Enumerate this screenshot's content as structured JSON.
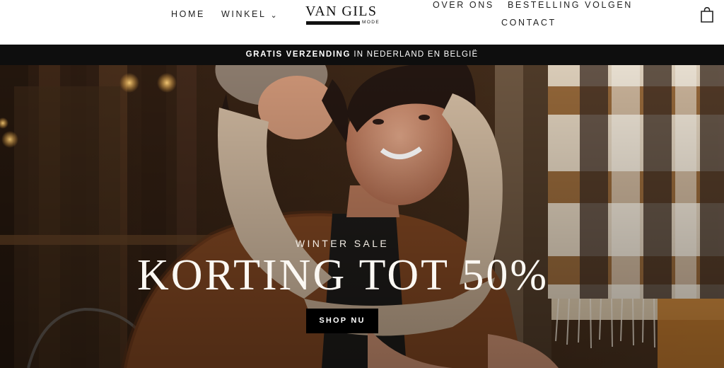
{
  "header": {
    "nav_left": {
      "home": "HOME",
      "winkel": "WINKEL"
    },
    "nav_right": {
      "over_ons": "OVER ONS",
      "bestelling": "BESTELLING VOLGEN",
      "contact": "CONTACT"
    },
    "logo": {
      "name": "VAN GILS",
      "sub": "MODE"
    },
    "cart_icon": "shopping-bag-icon"
  },
  "announcement": {
    "bold": "GRATIS VERZENDING",
    "text": " IN NEDERLAND EN BELGIË"
  },
  "hero": {
    "kicker": "WINTER SALE",
    "title": "KORTING TOT 50%",
    "button": "SHOP NU"
  },
  "colors": {
    "announcement_bg": "#0e0e0e",
    "button_bg": "#000000",
    "hero_text": "#fbf8f3"
  }
}
